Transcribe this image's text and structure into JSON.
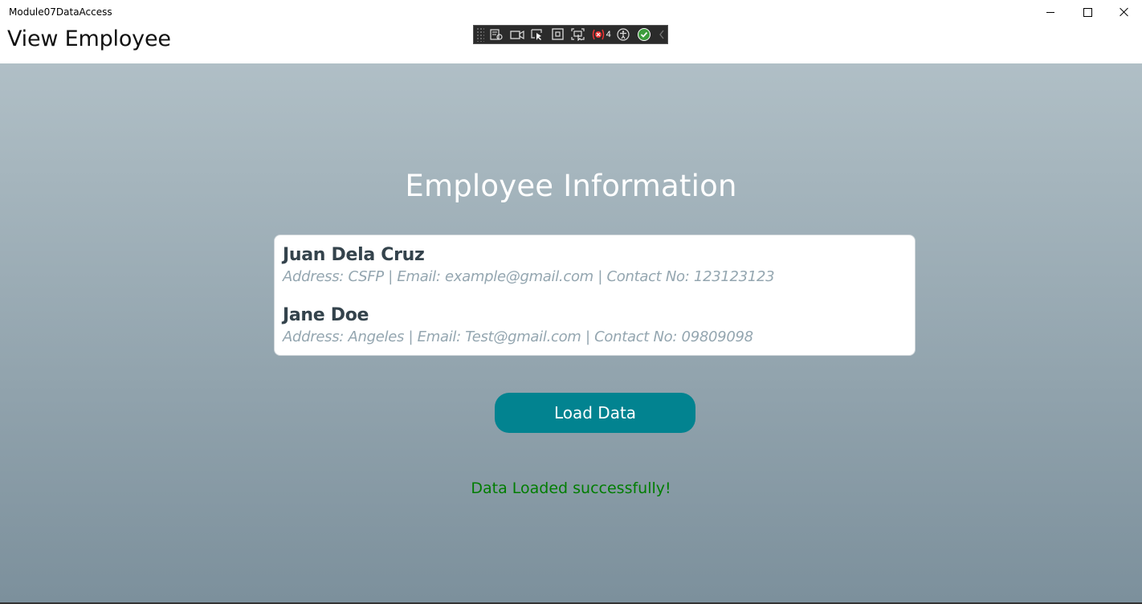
{
  "window": {
    "app_name": "Module07DataAccess",
    "minimize_icon": "minimize-icon",
    "maximize_icon": "maximize-icon",
    "close_icon": "close-icon"
  },
  "header": {
    "title": "View Employee"
  },
  "debug_toolbar": {
    "icons": [
      "live-visual-tree-icon",
      "record-icon",
      "select-element-icon",
      "display-layout-adorners-icon",
      "track-focus-icon",
      "binding-failures-icon",
      "accessibility-icon",
      "hot-reload-check-icon",
      "collapse-chevron-icon"
    ],
    "binding_failures_count": "4"
  },
  "main": {
    "section_title": "Employee Information",
    "employees": [
      {
        "name": "Juan Dela Cruz",
        "details": "Address: CSFP | Email: example@gmail.com | Contact No: 123123123"
      },
      {
        "name": "Jane Doe",
        "details": "Address: Angeles | Email: Test@gmail.com | Contact No: 09809098"
      }
    ],
    "load_button_label": "Load Data",
    "status_message": "Data Loaded successfully!"
  },
  "colors": {
    "gradient_top": "#b0bfc6",
    "gradient_bottom": "#7c909c",
    "button": "#028390",
    "status_text": "#007d00",
    "employee_name": "#34434c",
    "employee_details": "#94a6b0"
  }
}
